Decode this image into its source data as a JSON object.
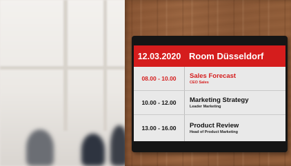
{
  "sign": {
    "header": {
      "date": "12.03.2020",
      "room": "Room Düsseldorf"
    },
    "meetings": [
      {
        "time": "08.00 - 10.00",
        "title": "Sales Forecast",
        "subtitle": "CEO Sales",
        "active": true
      },
      {
        "time": "10.00 - 12.00",
        "title": "Marketing Strategy",
        "subtitle": "Leader Marketing",
        "active": false
      },
      {
        "time": "13.00 - 16.00",
        "title": "Product Review",
        "subtitle": "Head of Product Marketing",
        "active": false
      }
    ]
  },
  "colors": {
    "accent": "#d51d1d",
    "frame": "#151515",
    "wood": "#9b6641"
  }
}
